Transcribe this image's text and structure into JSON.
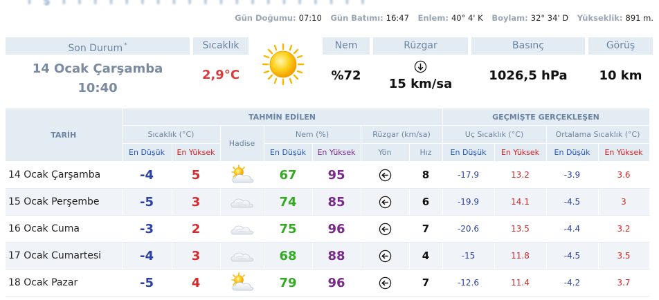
{
  "meta": [
    {
      "label": "Gün Doğumu:",
      "value": "07:10"
    },
    {
      "label": "Gün Batımı:",
      "value": "16:47"
    },
    {
      "label": "Enlem:",
      "value": "40° 4' K"
    },
    {
      "label": "Boylam:",
      "value": "32° 34' D"
    },
    {
      "label": "Yükseklik:",
      "value": "891 m."
    }
  ],
  "current": {
    "headers": {
      "son_durum": "Son Durum",
      "asterisk": "*",
      "sicaklik": "Sıcaklık",
      "nem": "Nem",
      "ruzgar": "Rüzgar",
      "basinc": "Basınç",
      "gorus": "Görüş"
    },
    "date": "14 Ocak Çarşamba",
    "time": "10:40",
    "temp": "2,9°C",
    "humidity": "%72",
    "wind": "15 km/sa",
    "pressure": "1026,5 hPa",
    "visibility": "10 km",
    "weather_icon": "sun-icon",
    "wind_icon": "arrow-down-circle-icon"
  },
  "forecast": {
    "group_predicted": "TAHMİN EDİLEN",
    "group_past": "GEÇMİŞTE GERÇEKLEŞEN",
    "tarih": "TARİH",
    "sub": {
      "sicaklik": "Sıcaklık (°C)",
      "hadise": "Hadise",
      "nem": "Nem (%)",
      "ruzgar": "Rüzgar (km/sa)",
      "uc": "Uç Sıcaklık (°C)",
      "ort": "Ortalama Sıcaklık (°C)"
    },
    "cols": {
      "en_dusuk": "En Düşük",
      "en_yuksek": "En Yüksek",
      "yon": "Yön",
      "hiz": "Hız"
    },
    "rows": [
      {
        "date": "14 Ocak Çarşamba",
        "tlo": "-4",
        "thi": "5",
        "icon": "sun-cloud-icon",
        "nlo": "67",
        "nhi": "95",
        "dir": "arrow-left-icon",
        "spd": "8",
        "ulo": "-17.9",
        "uhi": "13.2",
        "olo": "-3.9",
        "ohi": "3.6"
      },
      {
        "date": "15 Ocak Perşembe",
        "tlo": "-5",
        "thi": "3",
        "icon": "cloud-icon",
        "nlo": "74",
        "nhi": "85",
        "dir": "arrow-left-icon",
        "spd": "6",
        "ulo": "-19.9",
        "uhi": "14.1",
        "olo": "-4.5",
        "ohi": "3"
      },
      {
        "date": "16 Ocak Cuma",
        "tlo": "-3",
        "thi": "2",
        "icon": "cloud-icon",
        "nlo": "75",
        "nhi": "96",
        "dir": "arrow-left-icon",
        "spd": "7",
        "ulo": "-20.6",
        "uhi": "13.5",
        "olo": "-4.4",
        "ohi": "3.2"
      },
      {
        "date": "17 Ocak Cumartesi",
        "tlo": "-4",
        "thi": "3",
        "icon": "cloud-icon",
        "nlo": "68",
        "nhi": "88",
        "dir": "arrow-left-icon",
        "spd": "4",
        "ulo": "-15",
        "uhi": "11.8",
        "olo": "-4.5",
        "ohi": "3.5"
      },
      {
        "date": "18 Ocak Pazar",
        "tlo": "-5",
        "thi": "4",
        "icon": "sun-cloud-icon",
        "nlo": "79",
        "nhi": "96",
        "dir": "arrow-left-icon",
        "spd": "7",
        "ulo": "-12.6",
        "uhi": "11.4",
        "olo": "-4.2",
        "ohi": "3.7"
      }
    ]
  },
  "colors": {
    "header_bg": "#e4ecf3",
    "header_text": "#6a84a4",
    "temp_red": "#d93b3b",
    "low_blue": "#2a3fa8",
    "nem_green": "#33aa22",
    "nem_purple": "#7a2a8a"
  }
}
